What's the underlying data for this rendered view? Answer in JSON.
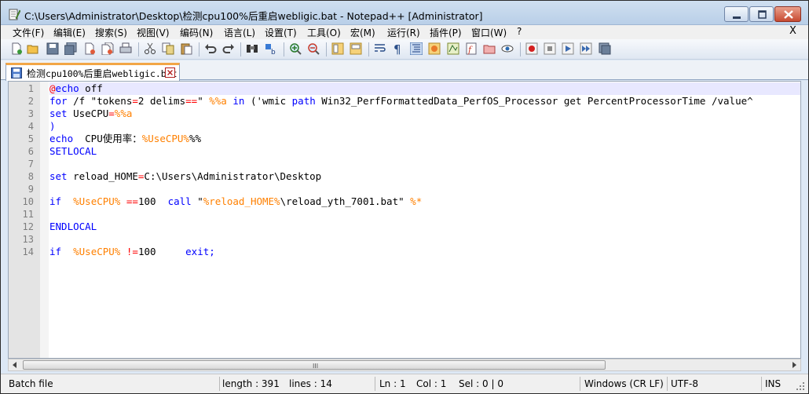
{
  "window": {
    "title": "C:\\Users\\Administrator\\Desktop\\检测cpu100%后重启webligic.bat - Notepad++ [Administrator]"
  },
  "menu": {
    "items": [
      "文件(F)",
      "编辑(E)",
      "搜索(S)",
      "视图(V)",
      "编码(N)",
      "语言(L)",
      "设置(T)",
      "工具(O)",
      "宏(M)",
      "运行(R)",
      "插件(P)",
      "窗口(W)",
      "?"
    ],
    "close_label": "X"
  },
  "tab": {
    "label_cn1": "检测",
    "label_mono1": "cpu100%",
    "label_cn2": "后重启",
    "label_mono2": "webligic.bat"
  },
  "editor": {
    "line_numbers": [
      "1",
      "2",
      "3",
      "4",
      "5",
      "6",
      "7",
      "8",
      "9",
      "10",
      "11",
      "12",
      "13",
      "14"
    ],
    "lines": {
      "l1": {
        "op": "@",
        "kw": "echo",
        "txt": " off"
      },
      "l2": {
        "kw1": "for",
        "t1": " /f \"tokens",
        "op1": "=",
        "t2": "2 delims",
        "op2": "==",
        "t3": "\" ",
        "v1": "%%a",
        "t4": " ",
        "kw2": "in",
        "t5": " ('wmic ",
        "kw3": "path",
        "t6": " Win32_PerfFormattedData_PerfOS_Processor get PercentProcessorTime /value^"
      },
      "l3": {
        "kw": "set",
        "t1": " UseCPU",
        "op": "=",
        "v": "%%a"
      },
      "l4": {
        "op": ")"
      },
      "l5": {
        "kw": "echo",
        "t1": "  CPU使用率：",
        "v": "%UseCPU%",
        "t2": "%%"
      },
      "l6": {
        "kw": "SETLOCAL"
      },
      "l8": {
        "kw": "set",
        "t1": " reload_HOME",
        "op": "=",
        "t2": "C:\\Users\\Administrator\\Desktop"
      },
      "l10": {
        "kw1": "if",
        "t1": "  ",
        "v1": "%UseCPU%",
        "t2": " ",
        "op": "==",
        "t3": "100  ",
        "kw2": "call",
        "t4": " \"",
        "v2": "%reload_HOME%",
        "t5": "\\reload_yth_7001.bat\" ",
        "v3": "%*"
      },
      "l12": {
        "kw": "ENDLOCAL"
      },
      "l14": {
        "kw1": "if",
        "t1": "  ",
        "v1": "%UseCPU%",
        "t2": " ",
        "op": "!=",
        "t3": "100     ",
        "kw2": "exit;"
      }
    }
  },
  "scrollbar": {
    "grip": "III"
  },
  "status": {
    "filetype": "Batch file",
    "length": "length : 391",
    "lines": "lines : 14",
    "ln": "Ln : 1",
    "col": "Col : 1",
    "sel": "Sel : 0 | 0",
    "eol": "Windows (CR LF)",
    "encoding": "UTF-8",
    "mode": "INS"
  },
  "colors": {
    "keyword": "#0000ff",
    "variable": "#ff8000",
    "operator": "#ff0000",
    "current_line": "#e8e8ff",
    "tab_accent": "#f2a646"
  }
}
